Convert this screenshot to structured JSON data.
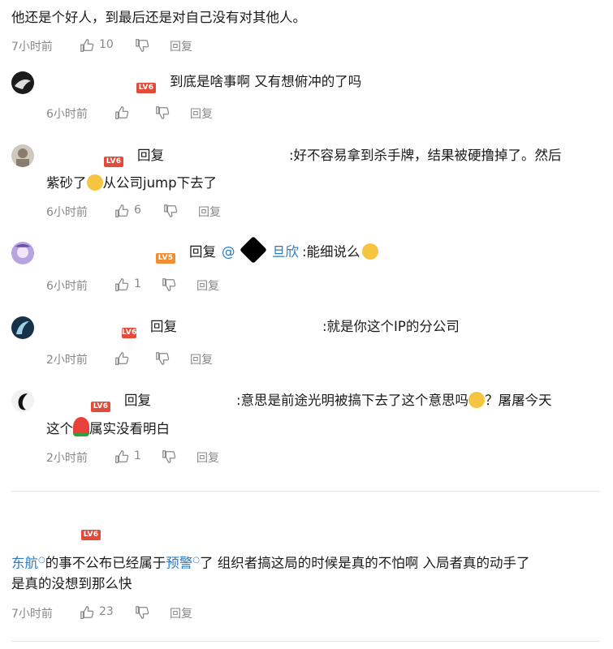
{
  "comments": [
    {
      "text": "他还是个好人，到最后还是对自己没有对其他人。",
      "time": "7小时前",
      "likes": "10",
      "reply_label": "回复"
    },
    {
      "text": "到底是啥事啊 又有想俯冲的了吗",
      "level": "LV6",
      "time": "6小时前",
      "likes": "",
      "reply_label": "回复"
    },
    {
      "reply_word": "回复",
      "text_line1": ":好不容易拿到杀手牌，结果被硬撸掉了。然后",
      "text_line2_a": "紫砂了",
      "text_line2_b": "从公司jump下去了",
      "level": "LV6",
      "time": "6小时前",
      "likes": "6",
      "reply_label": "回复"
    },
    {
      "reply_word": "回复",
      "mention": "@",
      "mention_tail": "旦欣",
      "text": ":能细说么",
      "level": "LV5",
      "time": "6小时前",
      "likes": "1",
      "reply_label": "回复"
    },
    {
      "reply_word": "回复",
      "text": ":就是你这个IP的分公司",
      "level": "LV6",
      "time": "2小时前",
      "likes": "",
      "reply_label": "回复"
    },
    {
      "reply_word": "回复",
      "text_line1_a": ":意思是前途光明被搞下去了这个意思吗",
      "text_line1_b": "？屠屠今天",
      "text_line2_a": "这个",
      "text_line2_b": "属实没看明白",
      "level": "LV6",
      "time": "2小时前",
      "likes": "1",
      "reply_label": "回复"
    },
    {
      "level": "LV6",
      "link1": "东航",
      "text_a": "的事不公布已经属于",
      "link2": "预警",
      "text_b": "了 组织者搞这局的时候是真的不怕啊 入局者真的动手了",
      "text_line2": "是真的没想到那么快",
      "time": "7小时前",
      "likes": "23",
      "reply_label": "回复"
    }
  ],
  "colors": {
    "level_red": "#e24b3a",
    "level_orange": "#f08c32",
    "link_blue": "#2b7bbf",
    "meta_gray": "#888888"
  },
  "icons": [
    "thumb-up-icon",
    "thumb-down-icon",
    "laugh-cry-emoji-icon",
    "watermelon-emoji-icon",
    "smile-emoji-icon"
  ]
}
